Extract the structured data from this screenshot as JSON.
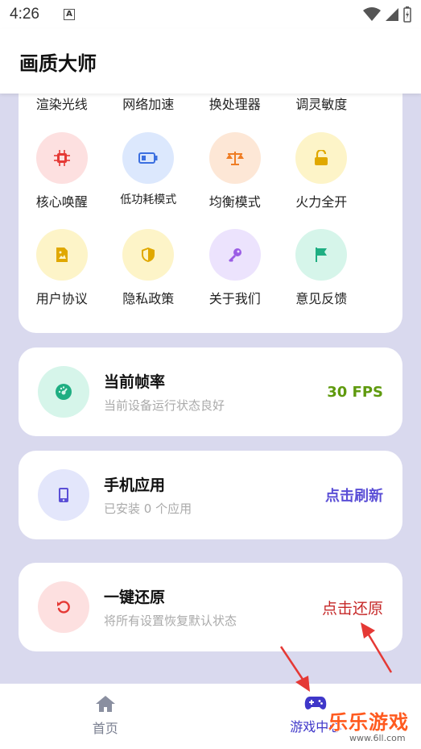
{
  "status_bar": {
    "time": "4:26",
    "notif_letter": "A"
  },
  "app_bar": {
    "title": "画质大师"
  },
  "tools_top_row": [
    "渲染光线",
    "网络加速",
    "换处理器",
    "调灵敏度"
  ],
  "tools_row1": [
    {
      "label": "核心唤醒",
      "icon": "chip-icon",
      "bg": "#fde0e0",
      "fg": "#e53935"
    },
    {
      "label": "低功耗模式",
      "icon": "battery-icon",
      "bg": "#dce8fd",
      "fg": "#3b6fe0"
    },
    {
      "label": "均衡模式",
      "icon": "balance-scale-icon",
      "bg": "#fde7d6",
      "fg": "#ef7d24"
    },
    {
      "label": "火力全开",
      "icon": "unlock-icon",
      "bg": "#fdf4c8",
      "fg": "#e0a800"
    }
  ],
  "tools_row2": [
    {
      "label": "用户协议",
      "icon": "document-icon",
      "bg": "#fdf4c8",
      "fg": "#e0a800"
    },
    {
      "label": "隐私政策",
      "icon": "shield-icon",
      "bg": "#fdf4c8",
      "fg": "#e0a800"
    },
    {
      "label": "关于我们",
      "icon": "key-icon",
      "bg": "#ece3fd",
      "fg": "#9b5de5"
    },
    {
      "label": "意见反馈",
      "icon": "flag-icon",
      "bg": "#d6f5ea",
      "fg": "#1fae82"
    }
  ],
  "fps_card": {
    "title": "当前帧率",
    "subtitle": "当前设备运行状态良好",
    "value": "30 FPS",
    "value_color": "#5f9a0e"
  },
  "apps_card": {
    "title": "手机应用",
    "subtitle": "已安装 0 个应用",
    "action": "点击刷新",
    "action_color": "#5b4fd6"
  },
  "restore_card": {
    "title": "一键还原",
    "subtitle": "将所有设置恢复默认状态",
    "action": "点击还原",
    "action_color": "#c62828"
  },
  "bottom_nav": {
    "home": "首页",
    "games": "游戏中心"
  },
  "watermark": {
    "text": "乐乐游戏",
    "url": "www.6ll.com"
  }
}
